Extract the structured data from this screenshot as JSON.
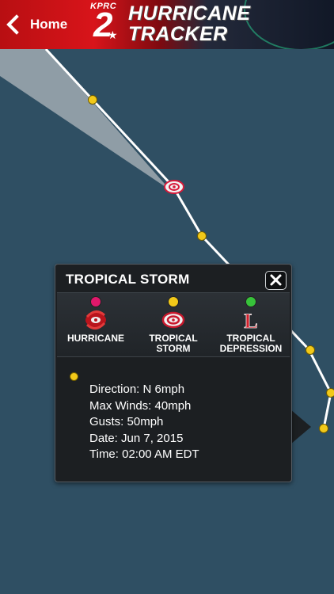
{
  "header": {
    "back_label": "Home",
    "station_name": "KPRC",
    "channel_number": "2",
    "title_line1": "HURRICANE",
    "title_line2": "TRACKER"
  },
  "map": {
    "point_color": "#f2c919",
    "track_color": "#ffffff",
    "storm_icon": "tropical-storm-icon"
  },
  "popup": {
    "title": "TROPICAL STORM",
    "close_icon": "close-icon",
    "legend": [
      {
        "label_line1": "HURRICANE",
        "label_line2": "",
        "dot_color": "#e0186b",
        "icon": "hurricane-icon"
      },
      {
        "label_line1": "TROPICAL",
        "label_line2": "STORM",
        "dot_color": "#f2c919",
        "icon": "tropical-storm-icon"
      },
      {
        "label_line1": "TROPICAL",
        "label_line2": "DEPRESSION",
        "dot_color": "#37c23a",
        "icon": "tropical-depression-icon"
      }
    ],
    "legend_symbol_text": "L",
    "details": {
      "direction": "Direction: N 6mph",
      "max_winds": "Max Winds: 40mph",
      "gusts": "Gusts: 50mph",
      "date": "Date: Jun 7, 2015",
      "time": "Time: 02:00 AM EDT"
    }
  }
}
